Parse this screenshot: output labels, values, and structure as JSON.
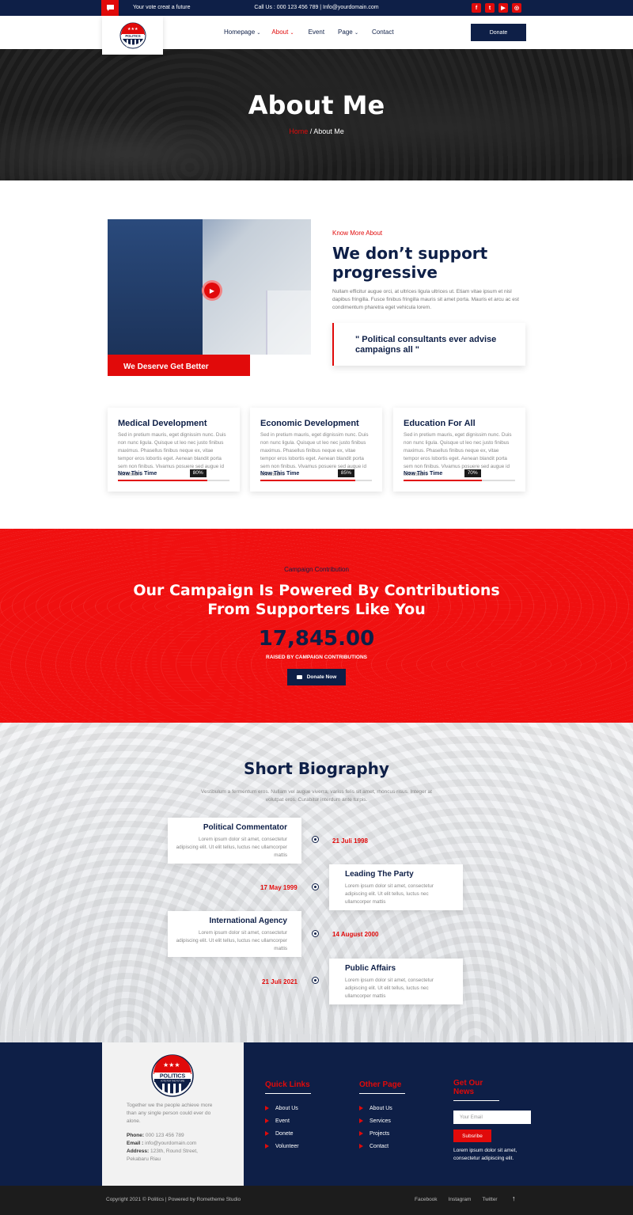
{
  "topbar": {
    "tagline": "Your vote creat a future",
    "contact": "Call Us : 000 123 456 789 | Info@yourdomain.com",
    "socials": [
      "facebook-icon",
      "twitter-icon",
      "youtube-icon",
      "instagram-icon"
    ]
  },
  "brand": {
    "logo_text": "POLITICS",
    "logo_sub": "VOTE FOR THE FUTURE"
  },
  "nav": {
    "items": [
      {
        "label": "Homepage",
        "dropdown": true
      },
      {
        "label": "About",
        "dropdown": true,
        "active": true
      },
      {
        "label": "Event",
        "dropdown": false
      },
      {
        "label": "Page",
        "dropdown": true
      },
      {
        "label": "Contact",
        "dropdown": false
      }
    ],
    "donate": "Donate"
  },
  "hero": {
    "title": "About Me",
    "crumb_home": "Home",
    "crumb_sep": " / ",
    "crumb_current": "About Me"
  },
  "about": {
    "image_caption": "We Deserve Get Better",
    "kicker": "Know More About",
    "title": "We don’t support progressive",
    "text": "Nullam efficitur augue orci, at ultrices ligula ultrices ut. Etiam vitae ipsum et nisl dapibus fringilla. Fusce finibus fringilla mauris sit amet porta. Mauris et arcu ac est condimentum pharetra eget vehicula lorem.",
    "quote": "\" Political consultants ever advise campaigns all \""
  },
  "cards": [
    {
      "title": "Medical Development",
      "text": "Sed in pretium mauris, eget dignissim nunc. Duis non nunc ligula. Quisque ut leo nec justo finibus maximus. Phasellus finibus neque ex, vitae tempor eros lobortis eget. Aenean blandit porta sem non finibus. Vivamus posuere sed augue id sollicitudin.",
      "bar_label": "Now This Time",
      "percent_label": "80%",
      "percent": 0.8
    },
    {
      "title": "Economic Development",
      "text": "Sed in pretium mauris, eget dignissim nunc. Duis non nunc ligula. Quisque ut leo nec justo finibus maximus. Phasellus finibus neque ex, vitae tempor eros lobortis eget. Aenean blandit porta sem non finibus. Vivamus posuere sed augue id sollicitudin.",
      "bar_label": "Now This Time",
      "percent_label": "85%",
      "percent": 0.85
    },
    {
      "title": "Education For All",
      "text": "Sed in pretium mauris, eget dignissim nunc. Duis non nunc ligula. Quisque ut leo nec justo finibus maximus. Phasellus finibus neque ex, vitae tempor eros lobortis eget. Aenean blandit porta sem non finibus. Vivamus posuere sed augue id sollicitudin.",
      "bar_label": "Now This Time",
      "percent_label": "70%",
      "percent": 0.7
    }
  ],
  "campaign": {
    "kicker": "Campaign Contribution",
    "headline_1": "Our Campaign Is Powered By Contributions",
    "headline_2": "From Supporters Like You",
    "amount": "17,845.00",
    "raised": "RAISED BY CAMPAIGN CONTRIBUTIONS",
    "button": "Donate Now"
  },
  "bio": {
    "title": "Short Biography",
    "intro": "Vestibulum a fermentum eros. Nullam vel augue viverra, varius felis sit amet, rhoncus risus. Integer at volutpat eros. Curabitur interdum ante turpis.",
    "items": [
      {
        "title": "Political Commentator",
        "text": "Lorem ipsum dolor sit amet, consectetur adipiscing elit. Ut elit tellus, luctus nec ullamcorper mattis",
        "date": "21 Juli 1998"
      },
      {
        "title": "Leading The Party",
        "text": "Lorem ipsum dolor sit amet, consectetur adipiscing elit. Ut elit tellus, luctus nec ullamcorper mattis",
        "date": "17 May 1999"
      },
      {
        "title": "International Agency",
        "text": "Lorem ipsum dolor sit amet, consectetur adipiscing elit. Ut elit tellus, luctus nec ullamcorper mattis",
        "date": "14 August 2000"
      },
      {
        "title": "Public Affairs",
        "text": "Lorem ipsum dolor sit amet, consectetur adipiscing elit. Ut elit tellus, luctus nec ullamcorper mattis",
        "date": "21 Juli 2021"
      }
    ]
  },
  "footer": {
    "desc": "Together we the people achieve more than any single person could ever do alone.",
    "phone_label": "Phone:",
    "phone": " 000 123 456 789",
    "email_label": "Email :",
    "email": " info@yourdomain.com",
    "address_label": "Address:",
    "address": " 123th, Round Street, Pekabaru Riau",
    "quick_title": "Quick Links",
    "quick": [
      "About Us",
      "Event",
      "Donete",
      "Volunteer"
    ],
    "other_title": "Other Page",
    "other": [
      "About Us",
      "Services",
      "Projects",
      "Contact"
    ],
    "news_title": "Get Our News",
    "news_placeholder": "Your Email",
    "subscribe": "Subsribe",
    "news_text": "Lorem ipsum dolor sit amet, consectetur adipiscing elit."
  },
  "bottom": {
    "copyright": "Copyright 2021 © Politics | Powered by Rometheme Studio",
    "links": [
      "Facebook",
      "Instagram",
      "Twitter"
    ],
    "up": "↑"
  },
  "colors": {
    "navy": "#0e1f47",
    "red": "#e10a0a"
  }
}
